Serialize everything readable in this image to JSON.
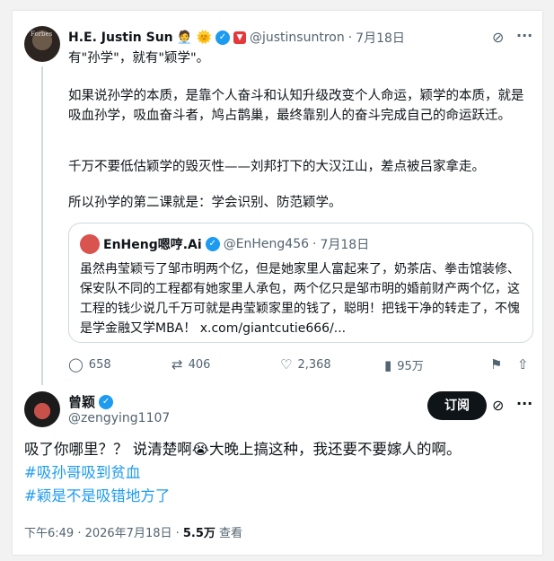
{
  "tweet1": {
    "name": "H.E. Justin Sun",
    "name_emojis": "🧑‍💼 🌞",
    "handle": "@justinsuntron",
    "date": "7月18日",
    "avatar_text": "Forbes",
    "paragraphs": [
      "有\"孙学\"，就有\"颖学\"。",
      "如果说孙学的本质，是靠个人奋斗和认知升级改变个人命运，颖学的本质，就是吸血孙学，吸血奋斗者，鸠占鹊巢，最终靠别人的奋斗完成自己的命运跃迁。",
      "千万不要低估颖学的毁灭性——刘邦打下的大汉江山，差点被吕家拿走。",
      "所以孙学的第二课就是：学会识别、防范颖学。"
    ],
    "quote": {
      "name": "EnHeng嗯哼.Ai",
      "handle": "@EnHeng456",
      "date": "7月18日",
      "text": "虽然冉莹颖亏了邹市明两个亿，但是她家里人富起来了，奶茶店、拳击馆装修、保安队不同的工程都有她家里人承包，两个亿只是邹市明的婚前财产两个亿，这工程的钱少说几千万可就是冉莹颖家里的钱了，聪明！把钱干净的转走了，不愧是学金融又学MBA！ x.com/giantcutie666/..."
    },
    "stats": {
      "replies": "658",
      "reposts": "406",
      "likes": "2,368",
      "views": "95万"
    }
  },
  "tweet2": {
    "name": "曾颖",
    "handle": "@zengying1107",
    "follow_label": "订阅",
    "text": "吸了你哪里？？ 说清楚啊😭大晚上搞这种，我还要不要嫁人的啊。",
    "hashtags": [
      "#吸孙哥吸到贫血",
      "#颖是不是吸错地方了"
    ],
    "time": "下午6:49 · 2026年7月18日 · ",
    "views_count": "5.5万",
    "views_label": " 查看"
  },
  "icons": {
    "grok": "grok-icon",
    "more": "more-icon",
    "reply": "reply-icon",
    "repost": "repost-icon",
    "like": "like-icon",
    "views": "views-icon",
    "bookmark": "bookmark-icon",
    "share": "share-icon"
  },
  "colors": {
    "accent": "#1d9bf0",
    "text": "#0f1419",
    "muted": "#536471"
  }
}
